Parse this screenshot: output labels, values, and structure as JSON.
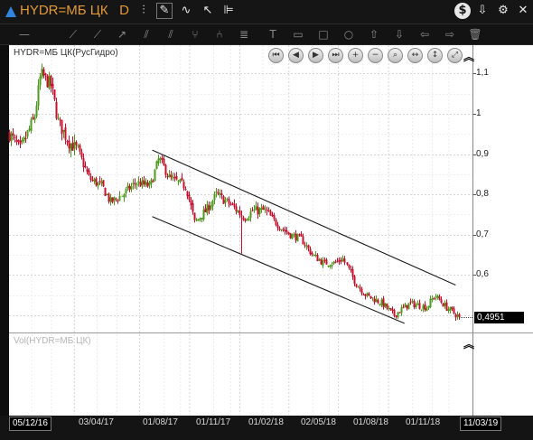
{
  "window": {
    "title": "HYDR=МБ ЦК   D",
    "brand_color": "#e39a2e"
  },
  "titlebar_tools": [
    {
      "icon": "chart-type-icon",
      "glyph": "⫶"
    },
    {
      "icon": "edit-pencil-icon",
      "glyph": "✎"
    },
    {
      "icon": "indicator-icon",
      "glyph": "∿"
    },
    {
      "icon": "cursor-arrow-icon",
      "glyph": "↖"
    },
    {
      "icon": "bars-list-icon",
      "glyph": "⊫"
    }
  ],
  "window_controls": [
    {
      "icon": "dollar-icon",
      "glyph": "$"
    },
    {
      "icon": "download-icon",
      "glyph": "⇩"
    },
    {
      "icon": "settings-gear-icon",
      "glyph": "⚙"
    },
    {
      "icon": "close-icon",
      "glyph": "✕"
    }
  ],
  "drawing_tools": [
    {
      "icon": "horizontal-line-icon",
      "glyph": "—"
    },
    {
      "icon": "ray-icon",
      "glyph": "⟋"
    },
    {
      "icon": "trend-line-icon",
      "glyph": "⟋"
    },
    {
      "icon": "arrow-line-icon",
      "glyph": "↗"
    },
    {
      "icon": "parallel-channel-icon",
      "glyph": "⫽"
    },
    {
      "icon": "regression-channel-icon",
      "glyph": "⫽"
    },
    {
      "icon": "pitchfork-icon",
      "glyph": "⑂"
    },
    {
      "icon": "fan-icon",
      "glyph": "⑃"
    },
    {
      "icon": "fibonacci-icon",
      "glyph": "≣"
    },
    {
      "icon": "text-tool-icon",
      "glyph": "T"
    },
    {
      "icon": "label-tool-icon",
      "glyph": "▭"
    },
    {
      "icon": "rectangle-tool-icon",
      "glyph": "□"
    },
    {
      "icon": "ellipse-tool-icon",
      "glyph": "○"
    },
    {
      "icon": "arrow-up-icon",
      "glyph": "⇧"
    },
    {
      "icon": "arrow-down-icon",
      "glyph": "⇩"
    },
    {
      "icon": "arrow-left-icon",
      "glyph": "⇦"
    },
    {
      "icon": "arrow-right-icon",
      "glyph": "⇨"
    },
    {
      "icon": "trash-icon",
      "glyph": "🗑"
    }
  ],
  "price_pane": {
    "label": "HYDR=МБ ЦК(РусГидро)",
    "label_color": "#333333"
  },
  "volume_pane": {
    "label": "Vol(HYDR=МБ ЦК)",
    "label_color": "#b5b5b5"
  },
  "nav_controls": [
    {
      "icon": "rewind-start-icon",
      "glyph": "⏮"
    },
    {
      "icon": "step-back-icon",
      "glyph": "◀"
    },
    {
      "icon": "play-icon",
      "glyph": "▶"
    },
    {
      "icon": "fast-forward-icon",
      "glyph": "⏭"
    },
    {
      "icon": "zoom-in-icon",
      "glyph": "+"
    },
    {
      "icon": "zoom-out-icon",
      "glyph": "−"
    },
    {
      "icon": "magnify-icon",
      "glyph": "⌕"
    },
    {
      "icon": "fit-horizontal-icon",
      "glyph": "↔"
    },
    {
      "icon": "fit-vertical-icon",
      "glyph": "↕"
    },
    {
      "icon": "expand-icon",
      "glyph": "⤢"
    }
  ],
  "price_axis": {
    "ticks": [
      "1,1",
      "1",
      "0,9",
      "0,8",
      "0,7",
      "0,6"
    ],
    "last_price": "0,4951"
  },
  "date_axis": {
    "start_label": "05/12/16",
    "end_label": "11/03/19",
    "labels": [
      "03/04/17",
      "01/08/17",
      "01/11/17",
      "01/02/18",
      "02/05/18",
      "01/08/18",
      "01/11/18"
    ]
  },
  "chart_data": {
    "type": "candlestick",
    "instrument": "HYDR=МБ ЦК(РусГидро)",
    "start_date": "05/12/16",
    "end_date": "11/03/19",
    "ylim": [
      0.45,
      1.15
    ],
    "y_ticks": [
      0.6,
      0.7,
      0.8,
      0.9,
      1.0,
      1.1
    ],
    "grid": true,
    "up_color": "#4e9a1f",
    "down_color": "#c8102e",
    "close_anchors": [
      {
        "date": "2016-12-05",
        "close": 0.95
      },
      {
        "date": "2016-12-25",
        "close": 0.91
      },
      {
        "date": "2017-01-20",
        "close": 0.99
      },
      {
        "date": "2017-02-01",
        "close": 1.1
      },
      {
        "date": "2017-02-20",
        "close": 1.07
      },
      {
        "date": "2017-03-05",
        "close": 0.98
      },
      {
        "date": "2017-03-25",
        "close": 0.93
      },
      {
        "date": "2017-04-10",
        "close": 0.91
      },
      {
        "date": "2017-05-01",
        "close": 0.84
      },
      {
        "date": "2017-05-25",
        "close": 0.82
      },
      {
        "date": "2017-06-10",
        "close": 0.78
      },
      {
        "date": "2017-07-01",
        "close": 0.8
      },
      {
        "date": "2017-07-25",
        "close": 0.83
      },
      {
        "date": "2017-08-20",
        "close": 0.82
      },
      {
        "date": "2017-09-05",
        "close": 0.89
      },
      {
        "date": "2017-09-25",
        "close": 0.84
      },
      {
        "date": "2017-10-25",
        "close": 0.82
      },
      {
        "date": "2017-11-10",
        "close": 0.73
      },
      {
        "date": "2017-12-01",
        "close": 0.76
      },
      {
        "date": "2017-12-20",
        "close": 0.8
      },
      {
        "date": "2018-01-20",
        "close": 0.77
      },
      {
        "date": "2018-02-10",
        "close": 0.74
      },
      {
        "date": "2018-02-25",
        "close": 0.76
      },
      {
        "date": "2018-03-20",
        "close": 0.76
      },
      {
        "date": "2018-04-15",
        "close": 0.72
      },
      {
        "date": "2018-05-05",
        "close": 0.7
      },
      {
        "date": "2018-05-25",
        "close": 0.69
      },
      {
        "date": "2018-06-15",
        "close": 0.65
      },
      {
        "date": "2018-07-05",
        "close": 0.63
      },
      {
        "date": "2018-07-25",
        "close": 0.63
      },
      {
        "date": "2018-08-10",
        "close": 0.64
      },
      {
        "date": "2018-09-01",
        "close": 0.58
      },
      {
        "date": "2018-09-20",
        "close": 0.55
      },
      {
        "date": "2018-10-20",
        "close": 0.53
      },
      {
        "date": "2018-11-10",
        "close": 0.5
      },
      {
        "date": "2018-12-10",
        "close": 0.53
      },
      {
        "date": "2019-01-10",
        "close": 0.52
      },
      {
        "date": "2019-01-25",
        "close": 0.55
      },
      {
        "date": "2019-02-15",
        "close": 0.52
      },
      {
        "date": "2019-03-11",
        "close": 0.4951
      }
    ],
    "channel_lines": [
      {
        "from": {
          "date": "2017-08-25",
          "price": 0.91
        },
        "to": {
          "date": "2019-03-05",
          "price": 0.575
        }
      },
      {
        "from": {
          "date": "2017-08-25",
          "price": 0.745
        },
        "to": {
          "date": "2018-12-01",
          "price": 0.48
        }
      }
    ]
  }
}
